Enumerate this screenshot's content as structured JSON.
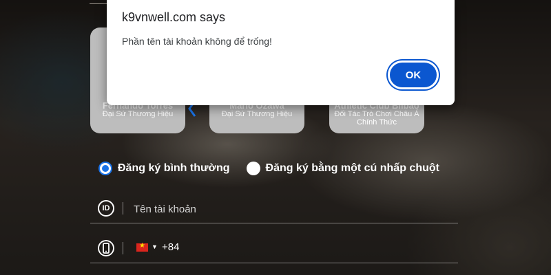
{
  "dialog": {
    "title": "k9vnwell.com says",
    "message": "Phần tên tài khoản không để trống!",
    "ok_label": "OK"
  },
  "ambassadors": [
    {
      "name": "Fernando Torres",
      "role": "Đại Sứ Thương Hiệu"
    },
    {
      "name": "Mario Ozawa",
      "role": "Đại Sứ Thương Hiệu"
    },
    {
      "name": "Athletic Club Bilbao",
      "role": "Đối Tác Trò Chơi Châu Á Chính Thức"
    }
  ],
  "registration": {
    "options": [
      {
        "label": "Đăng ký bình thường",
        "selected": true
      },
      {
        "label": "Đăng ký bằng một cú nhấp chuột",
        "selected": false
      }
    ],
    "username": {
      "icon": "id-icon",
      "icon_text": "ID",
      "placeholder": "Tên tài khoản",
      "value": ""
    },
    "phone": {
      "icon": "phone-icon",
      "country_flag": "vietnam-flag-icon",
      "country_code": "+84",
      "value": ""
    }
  },
  "colors": {
    "accent": "#0b57d0",
    "radio_selected": "#1a73e8"
  }
}
